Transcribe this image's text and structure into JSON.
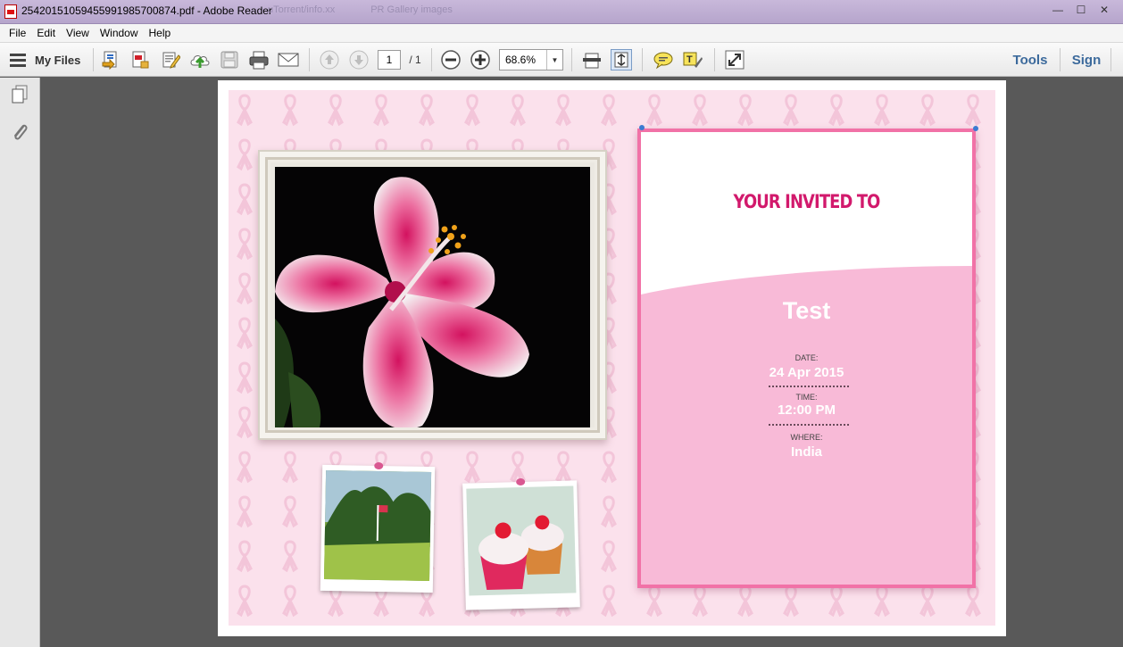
{
  "window": {
    "title": "25420151059455991985700874.pdf - Adobe Reader",
    "ghost_tabs": [
      "uTorrent/info.xx",
      "PR Gallery images"
    ],
    "minimize": "—",
    "maximize": "☐",
    "close": "✕"
  },
  "menu": [
    "File",
    "Edit",
    "View",
    "Window",
    "Help"
  ],
  "toolbar": {
    "my_files": "My Files",
    "page_current": "1",
    "page_total": "/ 1",
    "zoom": "68.6%",
    "tools": "Tools",
    "sign": "Sign"
  },
  "invitation": {
    "heading": "YOUR INVITED TO",
    "name": "Test",
    "date_label": "DATE:",
    "date_value": "24 Apr 2015",
    "time_label": "TIME:",
    "time_value": "12:00 PM",
    "where_label": "WHERE:",
    "where_value": "India"
  },
  "colors": {
    "accent_pink": "#f172a7",
    "panel_pink": "#f8bad7",
    "heading_pink": "#d2196c",
    "background_pink": "#fbe1ec",
    "link_blue": "#3c6a9c"
  },
  "icons": {
    "hamburger": "menu-icon",
    "create_pdf": "create-pdf-icon",
    "export_pdf": "export-pdf-icon",
    "edit": "edit-pdf-icon",
    "upload": "upload-cloud-icon",
    "save": "save-icon",
    "print": "print-icon",
    "email": "email-icon",
    "prev_page": "arrow-up-icon",
    "next_page": "arrow-down-icon",
    "zoom_out": "zoom-out-icon",
    "zoom_in": "zoom-in-icon",
    "fit_width": "fit-width-icon",
    "fit_page": "fit-page-icon",
    "comment": "comment-icon",
    "highlight": "highlight-icon",
    "fullscreen": "fullscreen-icon",
    "pages_panel": "pages-icon",
    "attachments": "paperclip-icon"
  }
}
